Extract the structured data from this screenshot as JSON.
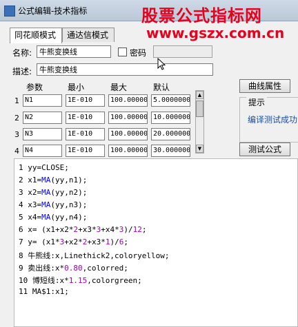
{
  "window": {
    "title": "公式编辑-技术指标"
  },
  "watermark": {
    "logo": "股票公式指标网",
    "url": "www.gszx.com.cn"
  },
  "tabs": [
    {
      "label": "同花顺模式"
    },
    {
      "label": "通达信模式"
    }
  ],
  "form": {
    "name_label": "名称:",
    "name_value": "牛熊变换线",
    "password_label": "密码",
    "password_value": "",
    "desc_label": "描述:",
    "desc_value": "牛熊变换线"
  },
  "params": {
    "headers": [
      "参数",
      "最小",
      "最大",
      "默认"
    ],
    "rows": [
      {
        "index": "1",
        "name": "N1",
        "min": "1E-010",
        "max": "100.00000",
        "default": "5.0000000"
      },
      {
        "index": "2",
        "name": "N2",
        "min": "1E-010",
        "max": "100.00000",
        "default": "10.000000"
      },
      {
        "index": "3",
        "name": "N3",
        "min": "1E-010",
        "max": "100.00000",
        "default": "20.000000"
      },
      {
        "index": "4",
        "name": "N4",
        "min": "1E-010",
        "max": "100.00000",
        "default": "30.000000"
      }
    ]
  },
  "buttons": {
    "curve_props": "曲线属性",
    "test_formula": "测试公式"
  },
  "hint": {
    "title": "提示",
    "message": "编译测试成功"
  },
  "code": {
    "line1": {
      "num": "1",
      "text": "yy=CLOSE;"
    },
    "line2": {
      "num": "2",
      "pre": "x1=",
      "fn": "MA",
      "post": "(yy,n1);"
    },
    "line3": {
      "num": "3",
      "pre": "x2=",
      "fn": "MA",
      "post": "(yy,n2);"
    },
    "line4": {
      "num": "4",
      "pre": "x3=",
      "fn": "MA",
      "post": "(yy,n3);"
    },
    "line5": {
      "num": "5",
      "pre": "x4=",
      "fn": "MA",
      "post": "(yy,n4);"
    },
    "line6": {
      "num": "6",
      "a": "x= (x1+x2*",
      "n1": "2",
      "b": "+x3*",
      "n2": "3",
      "c": "+x4*",
      "n3": "3",
      "d": ")/",
      "n4": "12",
      "e": ";"
    },
    "line7": {
      "num": "7",
      "a": "y= (x1*",
      "n1": "3",
      "b": "+x2*",
      "n2": "2",
      "c": "+x3*",
      "n3": "1",
      "d": ")/",
      "n4": "6",
      "e": ";"
    },
    "line8": {
      "num": "8",
      "text": "牛熊线:x,Linethick2,coloryellow;"
    },
    "line9": {
      "num": "9",
      "a": "卖出线:x*",
      "n1": "0.80",
      "b": ",colorred;"
    },
    "line10": {
      "num": "10",
      "a": "博短线:x*",
      "n1": "1.15",
      "b": ",colorgreen;"
    },
    "line11": {
      "num": "11",
      "text": "MA$1:x1;"
    }
  },
  "colors": {
    "accent_red": "#e8001c",
    "hint_blue": "#1a4fa3",
    "function_blue": "#0000ee",
    "number_purple": "#9b00b3"
  }
}
